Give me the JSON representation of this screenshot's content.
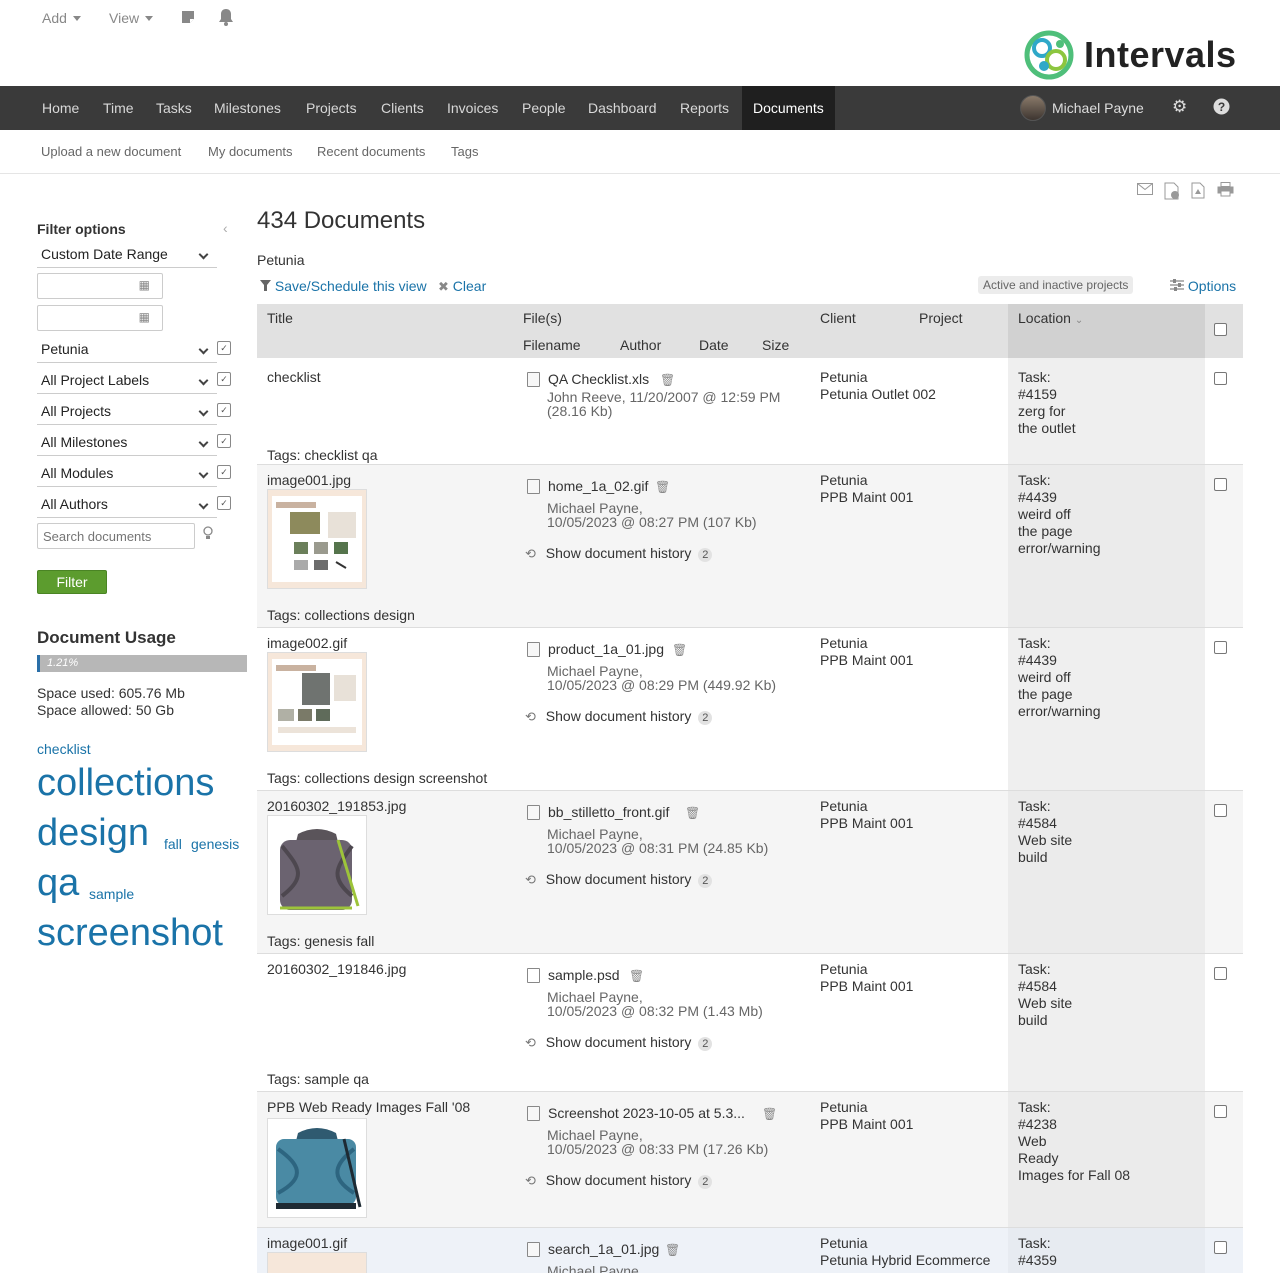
{
  "topbar": {
    "add_label": "Add",
    "view_label": "View",
    "logo_text": "Intervals"
  },
  "nav": {
    "items": [
      "Home",
      "Time",
      "Tasks",
      "Milestones",
      "Projects",
      "Clients",
      "Invoices",
      "People",
      "Dashboard",
      "Reports",
      "Documents"
    ],
    "active": "Documents",
    "user_name": "Michael Payne"
  },
  "subnav": [
    "Upload a new document",
    "My documents",
    "Recent documents",
    "Tags"
  ],
  "filters": {
    "title": "Filter options",
    "date_range": "Custom Date Range",
    "client": "Petunia",
    "project_labels": "All Project Labels",
    "projects": "All Projects",
    "milestones": "All Milestones",
    "modules": "All Modules",
    "authors": "All Authors",
    "search_placeholder": "Search documents",
    "filter_button": "Filter"
  },
  "usage": {
    "title": "Document Usage",
    "percent": 1.21,
    "percent_label": "1.21%",
    "space_used": "Space used: 605.76 Mb",
    "space_allowed": "Space allowed: 50 Gb"
  },
  "tag_cloud": [
    "checklist",
    "collections",
    "design",
    "fall",
    "genesis",
    "qa",
    "sample",
    "screenshot"
  ],
  "main": {
    "title": "434 Documents",
    "client_filter": "Petunia",
    "save_view": "Save/Schedule this view",
    "clear": "Clear",
    "projects_badge": "Active and inactive projects",
    "options": "Options"
  },
  "table": {
    "headers": {
      "title": "Title",
      "files": "File(s)",
      "filename": "Filename",
      "author": "Author",
      "date": "Date",
      "size": "Size",
      "client": "Client",
      "project": "Project",
      "location": "Location"
    },
    "history_label": "Show document history",
    "rows": [
      {
        "title": "checklist",
        "filename": "QA Checklist.xls",
        "meta1": "John Reeve, 11/20/2007 @ 12:59 PM",
        "meta2": "(28.16 Kb)",
        "client": "Petunia",
        "project": "Petunia Outlet 002",
        "loc1": "Task:",
        "loc2": "#4159",
        "loc3": "zerg for",
        "loc4": "the outlet",
        "tags": "Tags: checklist qa"
      },
      {
        "title": "image001.jpg",
        "filename": "home_1a_02.gif",
        "meta1": "Michael Payne,",
        "meta2": "10/05/2023 @ 08:27 PM (107 Kb)",
        "history_count": "2",
        "client": "Petunia",
        "project": "PPB Maint 001",
        "loc1": "Task:",
        "loc2": "#4439",
        "loc3": "weird off",
        "loc4": "the page",
        "loc5": "error/warning",
        "tags": "Tags: collections design"
      },
      {
        "title": "image002.gif",
        "filename": "product_1a_01.jpg",
        "meta1": "Michael Payne,",
        "meta2": "10/05/2023 @ 08:29 PM (449.92 Kb)",
        "history_count": "2",
        "client": "Petunia",
        "project": "PPB Maint 001",
        "loc1": "Task:",
        "loc2": "#4439",
        "loc3": "weird off",
        "loc4": "the page",
        "loc5": "error/warning",
        "tags": "Tags: collections design screenshot"
      },
      {
        "title": "20160302_191853.jpg",
        "filename": "bb_stilletto_front.gif",
        "meta1": "Michael Payne,",
        "meta2": "10/05/2023 @ 08:31 PM (24.85 Kb)",
        "history_count": "2",
        "client": "Petunia",
        "project": "PPB Maint 001",
        "loc1": "Task:",
        "loc2": "#4584",
        "loc3": "Web site",
        "loc4": "build",
        "tags": "Tags: genesis fall"
      },
      {
        "title": "20160302_191846.jpg",
        "filename": "sample.psd",
        "meta1": "Michael Payne,",
        "meta2": "10/05/2023 @ 08:32 PM (1.43 Mb)",
        "history_count": "2",
        "client": "Petunia",
        "project": "PPB Maint 001",
        "loc1": "Task:",
        "loc2": "#4584",
        "loc3": "Web site",
        "loc4": "build",
        "tags": "Tags: sample qa"
      },
      {
        "title": "PPB Web Ready Images Fall '08",
        "filename": "Screenshot 2023-10-05 at 5.3...",
        "meta1": "Michael Payne,",
        "meta2": "10/05/2023 @ 08:33 PM (17.26 Kb)",
        "history_count": "2",
        "client": "Petunia",
        "project": "PPB Maint 001",
        "loc1": "Task:",
        "loc2": "#4238",
        "loc3": "Web",
        "loc4": "Ready",
        "loc5": "Images for Fall 08"
      },
      {
        "title": "image001.gif",
        "filename": "search_1a_01.jpg",
        "meta1": "Michael Payne,",
        "client": "Petunia",
        "project": "Petunia Hybrid Ecommerce",
        "loc1": "Task:",
        "loc2": "#4359"
      }
    ]
  }
}
